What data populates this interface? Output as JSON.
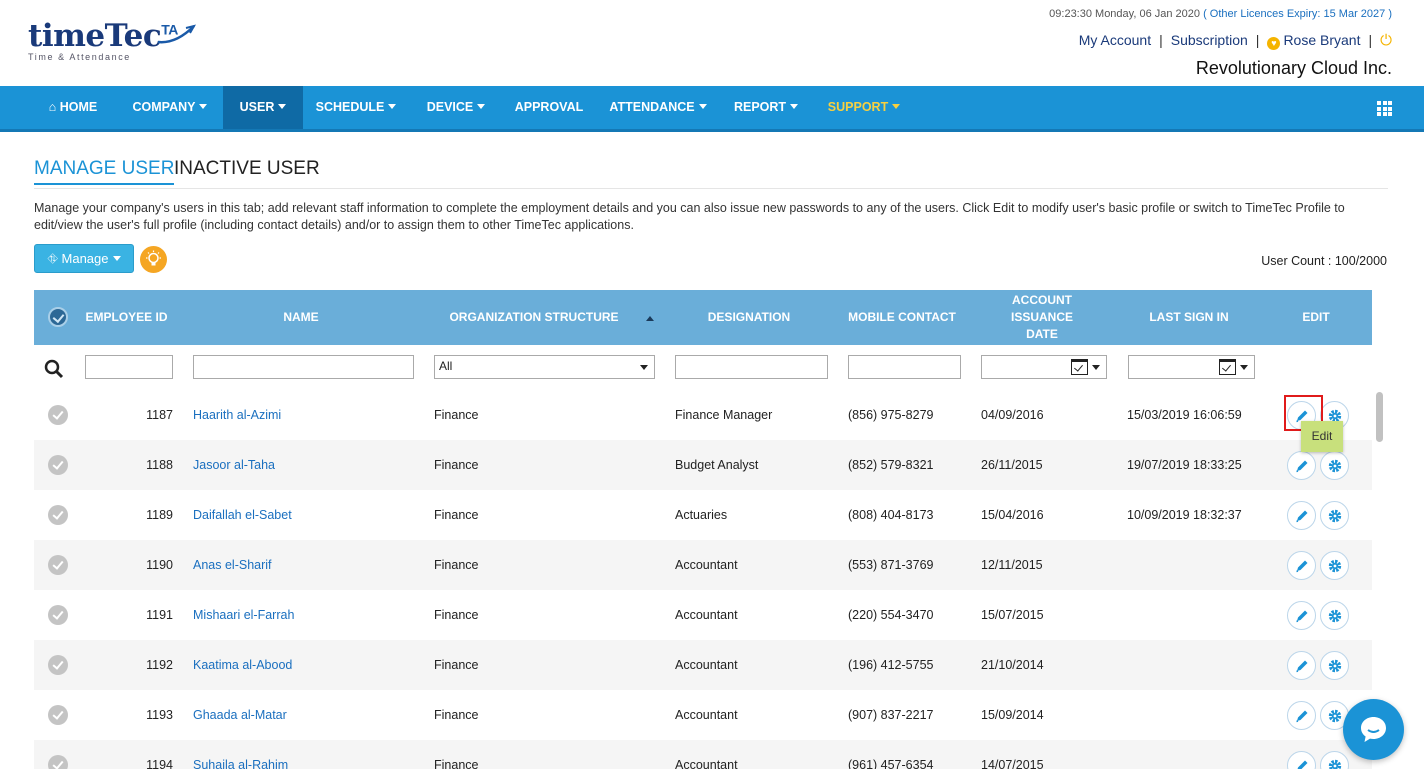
{
  "header": {
    "logo_brand": "timeTec",
    "logo_suffix": "TA",
    "logo_tagline": "Time & Attendance",
    "datetime": "09:23:30 Monday, 06 Jan 2020",
    "licence_expiry": "( Other Licences Expiry:  15 Mar 2027 )",
    "links": {
      "my_account": "My Account",
      "subscription": "Subscription",
      "user_name": "Rose Bryant"
    },
    "company_name": "Revolutionary Cloud Inc."
  },
  "nav": {
    "items": [
      {
        "label": "HOME",
        "icon": "home-icon"
      },
      {
        "label": "COMPANY",
        "dropdown": true
      },
      {
        "label": "USER",
        "dropdown": true,
        "active": true
      },
      {
        "label": "SCHEDULE",
        "dropdown": true
      },
      {
        "label": "DEVICE",
        "dropdown": true
      },
      {
        "label": "APPROVAL"
      },
      {
        "label": "ATTENDANCE",
        "dropdown": true
      },
      {
        "label": "REPORT",
        "dropdown": true
      },
      {
        "label": "SUPPORT",
        "dropdown": true
      }
    ],
    "apps_icon": "apps-grid-icon"
  },
  "tabs": {
    "manage_user": "MANAGE USER",
    "inactive_user": "INACTIVE USER"
  },
  "description": "Manage your company's users in this tab; add relevant staff information to complete the employment details and you can also issue new passwords to any of the users. Click Edit to modify user's basic profile or switch to TimeTec Profile to edit/view the user's full profile (including contact details) and/or to assign them to other TimeTec applications.",
  "toolbar": {
    "manage_label": "Manage",
    "user_count": "User Count : 100/2000"
  },
  "table": {
    "headers": {
      "employee_id": "EMPLOYEE ID",
      "name": "NAME",
      "org_structure": "ORGANIZATION STRUCTURE",
      "designation": "DESIGNATION",
      "mobile": "MOBILE CONTACT",
      "issuance_line1": "ACCOUNT ISSUANCE",
      "issuance_line2": "DATE",
      "last_sign_in": "LAST SIGN IN",
      "edit": "EDIT"
    },
    "filters": {
      "org_structure_selected": "All"
    },
    "rows": [
      {
        "id": "1187",
        "name": "Haarith al-Azimi",
        "org": "Finance",
        "designation": "Finance Manager",
        "mobile": "(856) 975-8279",
        "issued": "04/09/2016",
        "last_sign_in": "15/03/2019 16:06:59"
      },
      {
        "id": "1188",
        "name": "Jasoor al-Taha",
        "org": "Finance",
        "designation": "Budget Analyst",
        "mobile": "(852) 579-8321",
        "issued": "26/11/2015",
        "last_sign_in": "19/07/2019 18:33:25"
      },
      {
        "id": "1189",
        "name": "Daifallah el-Sabet",
        "org": "Finance",
        "designation": "Actuaries",
        "mobile": "(808) 404-8173",
        "issued": "15/04/2016",
        "last_sign_in": "10/09/2019 18:32:37"
      },
      {
        "id": "1190",
        "name": "Anas el-Sharif",
        "org": "Finance",
        "designation": "Accountant",
        "mobile": "(553) 871-3769",
        "issued": "12/11/2015",
        "last_sign_in": ""
      },
      {
        "id": "1191",
        "name": "Mishaari el-Farrah",
        "org": "Finance",
        "designation": "Accountant",
        "mobile": "(220) 554-3470",
        "issued": "15/07/2015",
        "last_sign_in": ""
      },
      {
        "id": "1192",
        "name": "Kaatima al-Abood",
        "org": "Finance",
        "designation": "Accountant",
        "mobile": "(196) 412-5755",
        "issued": "21/10/2014",
        "last_sign_in": ""
      },
      {
        "id": "1193",
        "name": "Ghaada al-Matar",
        "org": "Finance",
        "designation": "Accountant",
        "mobile": "(907) 837-2217",
        "issued": "15/09/2014",
        "last_sign_in": ""
      },
      {
        "id": "1194",
        "name": "Suhaila al-Rahim",
        "org": "Finance",
        "designation": "Accountant",
        "mobile": "(961) 457-6354",
        "issued": "14/07/2015",
        "last_sign_in": ""
      }
    ]
  },
  "tooltip": {
    "edit": "Edit"
  },
  "colors": {
    "nav_bg": "#1b93d6",
    "nav_active": "#0f6aa5",
    "table_header": "#6aaed9",
    "link": "#1a6fbf",
    "support": "#f7d040"
  }
}
